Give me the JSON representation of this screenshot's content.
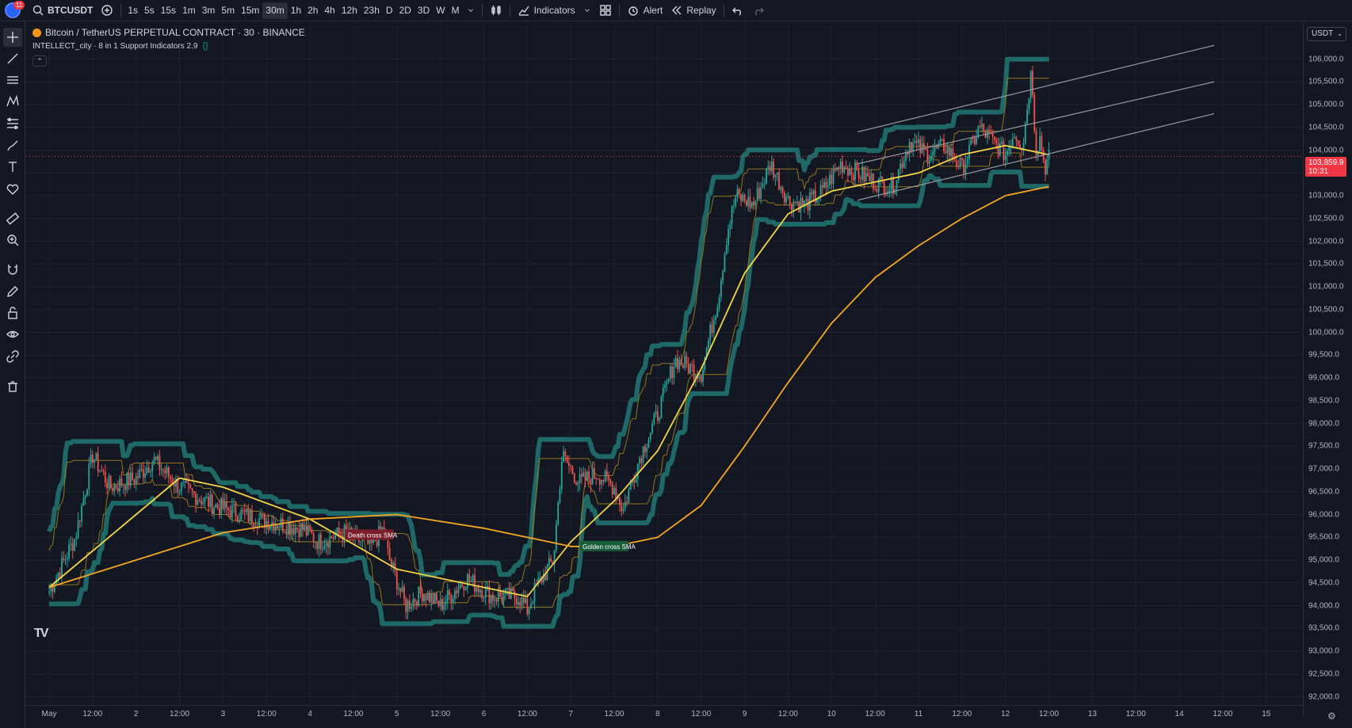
{
  "topbar": {
    "notification_count": "11",
    "symbol": "BTCUSDT",
    "intervals": [
      "1s",
      "5s",
      "15s",
      "1m",
      "3m",
      "5m",
      "15m",
      "30m",
      "1h",
      "2h",
      "4h",
      "12h",
      "23h",
      "D",
      "2D",
      "3D",
      "W",
      "M"
    ],
    "active_interval": "30m",
    "indicators_label": "Indicators",
    "alert_label": "Alert",
    "replay_label": "Replay"
  },
  "legend": {
    "title": "Bitcoin / TetherUS PERPETUAL CONTRACT · 30 · BINANCE",
    "indicator": "INTELLECT_city · 8 in 1 Support Indicators 2.9",
    "indicator_badge": "{}"
  },
  "price_axis": {
    "currency": "USDT",
    "labels": [
      "106,000.0",
      "105,500.0",
      "105,000.0",
      "104,500.0",
      "104,000.0",
      "103,500.0",
      "103,000.0",
      "102,500.0",
      "102,000.0",
      "101,500.0",
      "101,000.0",
      "100,500.0",
      "100,000.0",
      "99,500.0",
      "99,000.0",
      "98,500.0",
      "98,000.0",
      "97,500.0",
      "97,000.0",
      "96,500.0",
      "96,000.0",
      "95,500.0",
      "95,000.0",
      "94,500.0",
      "94,000.0",
      "93,500.0",
      "93,000.0",
      "92,500.0",
      "92,000.0"
    ],
    "last_price": "103,859.9",
    "countdown": "10:31"
  },
  "time_axis": {
    "labels": [
      "May",
      "12:00",
      "2",
      "12:00",
      "3",
      "12:00",
      "4",
      "12:00",
      "5",
      "12:00",
      "6",
      "12:00",
      "7",
      "12:00",
      "8",
      "12:00",
      "9",
      "12:00",
      "10",
      "12:00",
      "11",
      "12:00",
      "12",
      "12:00",
      "13",
      "12:00",
      "14",
      "12:00",
      "15"
    ]
  },
  "annotations": {
    "death_cross": "Death cross SMA",
    "golden_cross": "Golden cross SMA"
  },
  "colors": {
    "up": "#26a69a",
    "down": "#ef5350",
    "band": "#1f6e6b",
    "sma_fast": "#f5d547",
    "sma_slow": "#f5a623",
    "channel": "#9598a1",
    "last_price": "#f23645"
  },
  "chart_data": {
    "type": "candlestick",
    "symbol": "BTCUSDT",
    "interval": "30",
    "ylim": [
      91800,
      106500
    ],
    "last_price": 103859.9,
    "path": [
      [
        0,
        94300
      ],
      [
        0.3,
        95500
      ],
      [
        0.5,
        97300
      ],
      [
        0.7,
        96600
      ],
      [
        1.0,
        96800
      ],
      [
        1.2,
        97200
      ],
      [
        1.5,
        96600
      ],
      [
        1.9,
        96200
      ],
      [
        2.4,
        95900
      ],
      [
        2.9,
        95700
      ],
      [
        3.1,
        95400
      ],
      [
        3.4,
        95600
      ],
      [
        3.7,
        95300
      ],
      [
        3.85,
        95700
      ],
      [
        3.9,
        95100
      ],
      [
        4.1,
        94000
      ],
      [
        4.3,
        94300
      ],
      [
        4.5,
        94000
      ],
      [
        4.8,
        94600
      ],
      [
        5.1,
        94200
      ],
      [
        5.4,
        94200
      ],
      [
        5.5,
        93900
      ],
      [
        5.6,
        94400
      ],
      [
        5.8,
        95000
      ],
      [
        5.9,
        97300
      ],
      [
        6.1,
        96700
      ],
      [
        6.3,
        96900
      ],
      [
        6.5,
        96600
      ],
      [
        6.6,
        96100
      ],
      [
        6.8,
        97300
      ],
      [
        7.0,
        98200
      ],
      [
        7.2,
        99400
      ],
      [
        7.4,
        99200
      ],
      [
        7.5,
        99100
      ],
      [
        7.7,
        100800
      ],
      [
        7.8,
        102200
      ],
      [
        7.9,
        103000
      ],
      [
        8.1,
        102800
      ],
      [
        8.3,
        103700
      ],
      [
        8.5,
        102900
      ],
      [
        8.7,
        102800
      ],
      [
        8.9,
        103100
      ],
      [
        9.1,
        103700
      ],
      [
        9.3,
        103500
      ],
      [
        9.5,
        103300
      ],
      [
        9.7,
        103200
      ],
      [
        9.9,
        104200
      ],
      [
        10.1,
        103900
      ],
      [
        10.3,
        104100
      ],
      [
        10.5,
        103600
      ],
      [
        10.7,
        104500
      ],
      [
        10.9,
        104100
      ],
      [
        11.0,
        103900
      ],
      [
        11.1,
        104400
      ],
      [
        11.2,
        104100
      ],
      [
        11.3,
        105800
      ],
      [
        11.35,
        104000
      ],
      [
        11.4,
        104300
      ],
      [
        11.45,
        103600
      ],
      [
        11.5,
        103860
      ]
    ],
    "sma_fast": [
      [
        0,
        94400
      ],
      [
        1,
        96000
      ],
      [
        1.5,
        96800
      ],
      [
        2,
        96600
      ],
      [
        3,
        95900
      ],
      [
        4,
        94800
      ],
      [
        5,
        94400
      ],
      [
        5.5,
        94200
      ],
      [
        6,
        95400
      ],
      [
        6.5,
        96300
      ],
      [
        7,
        97400
      ],
      [
        7.5,
        99200
      ],
      [
        8,
        101300
      ],
      [
        8.5,
        102600
      ],
      [
        9,
        103100
      ],
      [
        9.5,
        103300
      ],
      [
        10,
        103500
      ],
      [
        10.5,
        103900
      ],
      [
        11,
        104100
      ],
      [
        11.5,
        103900
      ]
    ],
    "sma_slow": [
      [
        0,
        94400
      ],
      [
        1,
        95000
      ],
      [
        2,
        95600
      ],
      [
        3,
        95900
      ],
      [
        4,
        96000
      ],
      [
        5,
        95700
      ],
      [
        6,
        95300
      ],
      [
        6.5,
        95300
      ],
      [
        7,
        95500
      ],
      [
        7.5,
        96200
      ],
      [
        8,
        97500
      ],
      [
        8.5,
        98900
      ],
      [
        9,
        100200
      ],
      [
        9.5,
        101200
      ],
      [
        10,
        101900
      ],
      [
        10.5,
        102500
      ],
      [
        11,
        103000
      ],
      [
        11.5,
        103200
      ]
    ],
    "series": [
      {
        "name": "Death cross SMA",
        "x": 3.4,
        "y": 95550
      },
      {
        "name": "Golden cross SMA",
        "x": 6.1,
        "y": 95300
      }
    ],
    "channel": [
      {
        "from": [
          9.3,
          104400
        ],
        "to": [
          13.4,
          106300
        ]
      },
      {
        "from": [
          9.3,
          103700
        ],
        "to": [
          13.4,
          105500
        ]
      },
      {
        "from": [
          9.3,
          102900
        ],
        "to": [
          13.4,
          104800
        ]
      }
    ],
    "x_labels": [
      "May",
      "2",
      "3",
      "4",
      "5",
      "6",
      "7",
      "8",
      "9",
      "10",
      "11",
      "12",
      "13",
      "14",
      "15"
    ]
  }
}
